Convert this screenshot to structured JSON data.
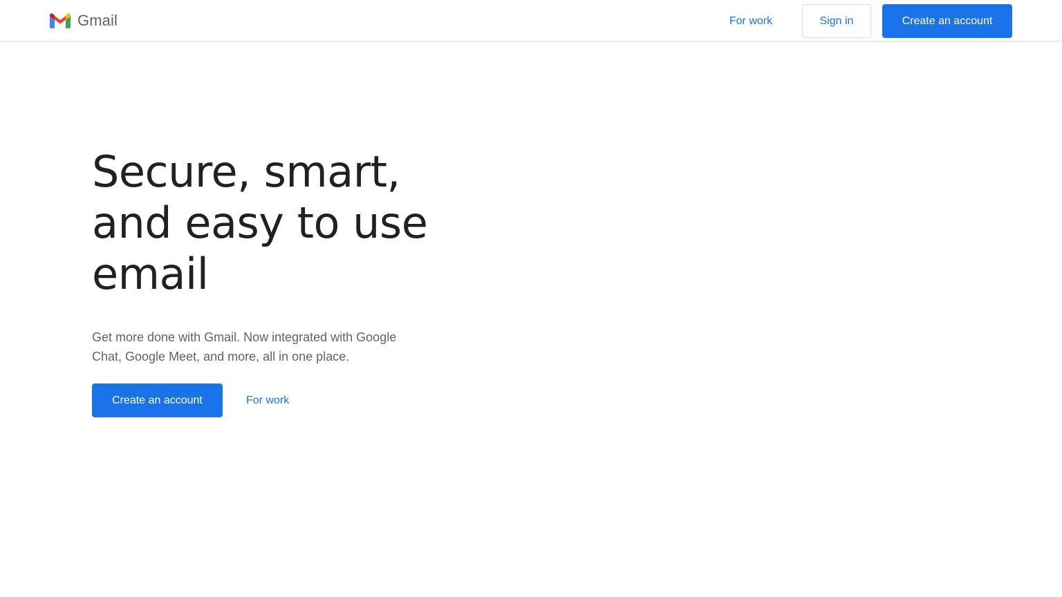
{
  "header": {
    "brand_name": "Gmail",
    "logo_icon": "gmail-m-logo",
    "nav": {
      "for_work_label": "For work",
      "sign_in_label": "Sign in",
      "create_account_label": "Create an account"
    }
  },
  "hero": {
    "title_lines": [
      "Secure, smart,",
      "and easy to use",
      "email"
    ],
    "subtitle": "Get more done with Gmail. Now integrated with Google Chat, Google Meet, and more, all in one place.",
    "primary_cta_label": "Create an account",
    "secondary_cta_label": "For work"
  },
  "colors": {
    "accent": "#1a73e8",
    "heading": "#202124",
    "body_text": "#5f6368",
    "logo_red": "#ea4335",
    "logo_blue": "#4285f4",
    "logo_green": "#34a853",
    "logo_yellow": "#fbbc04",
    "logo_dark_red": "#c5221f"
  }
}
